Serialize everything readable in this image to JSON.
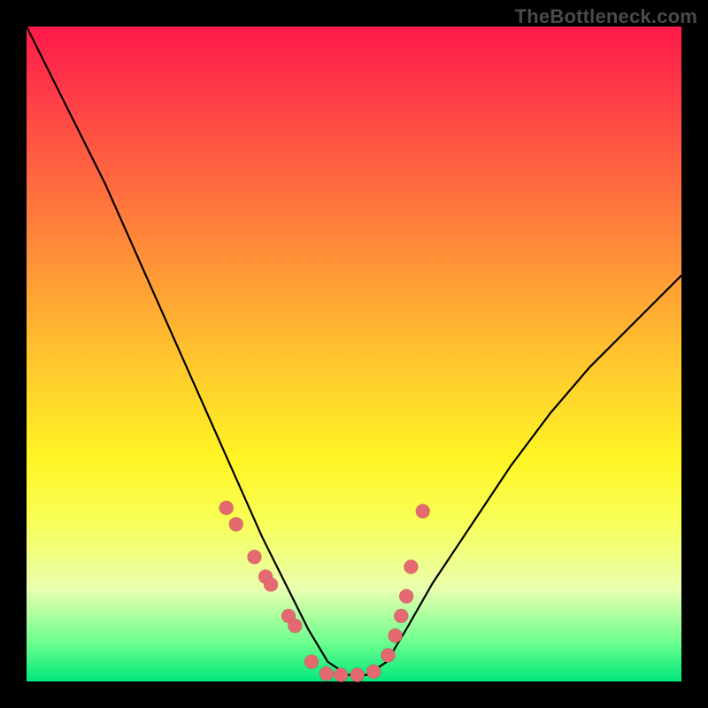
{
  "watermark": "TheBottleneck.com",
  "chart_data": {
    "type": "line",
    "title": "",
    "xlabel": "",
    "ylabel": "",
    "xlim": [
      0,
      100
    ],
    "ylim": [
      0,
      100
    ],
    "grid": false,
    "legend": false,
    "series": [
      {
        "name": "bottleneck-curve",
        "x": [
          0,
          4,
          8,
          12,
          16,
          20,
          24,
          28,
          32,
          36,
          40,
          43,
          46,
          49,
          52,
          55,
          58,
          62,
          68,
          74,
          80,
          86,
          92,
          100
        ],
        "y": [
          100,
          92,
          84,
          76,
          67,
          58,
          49,
          40,
          31,
          22,
          14,
          8,
          3,
          1,
          1,
          3,
          8,
          15,
          24,
          33,
          41,
          48,
          54,
          62
        ]
      }
    ],
    "points": {
      "name": "highlight-dots",
      "x": [
        30.5,
        32.0,
        34.8,
        36.5,
        37.3,
        40.0,
        41.0,
        43.5,
        45.8,
        48.0,
        50.5,
        53.0,
        55.2,
        56.3,
        57.2,
        58.0,
        58.7,
        60.5
      ],
      "y": [
        26.5,
        24.0,
        19.0,
        16.0,
        14.8,
        10.0,
        8.5,
        3.0,
        1.2,
        1.0,
        1.0,
        1.5,
        4.0,
        7.0,
        10.0,
        13.0,
        17.5,
        26.0
      ]
    },
    "background_gradient": {
      "top": "#ff1a4a",
      "mid": "#fff524",
      "bottom": "#00e87a"
    }
  }
}
